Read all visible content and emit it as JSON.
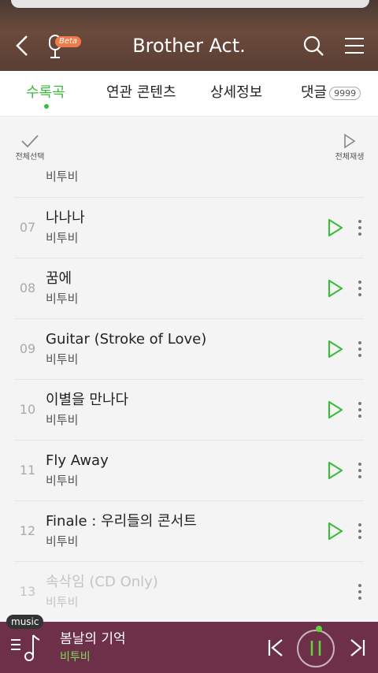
{
  "header": {
    "title": "Brother Act.",
    "beta_label": "Beta"
  },
  "tabs": [
    {
      "label": "수록곡",
      "active": true
    },
    {
      "label": "연관 콘텐츠",
      "active": false
    },
    {
      "label": "상세정보",
      "active": false
    },
    {
      "label": "댓글",
      "count": "9999",
      "active": false
    }
  ],
  "toolbar": {
    "select_all_label": "전체선택",
    "play_all_label": "전체재생"
  },
  "partial_row_artist": "비투비",
  "tracks": [
    {
      "num": "07",
      "title": "나나나",
      "artist": "비투비",
      "disabled": false
    },
    {
      "num": "08",
      "title": "꿈에",
      "artist": "비투비",
      "disabled": false
    },
    {
      "num": "09",
      "title": "Guitar (Stroke of Love)",
      "artist": "비투비",
      "disabled": false
    },
    {
      "num": "10",
      "title": "이별을 만나다",
      "artist": "비투비",
      "disabled": false
    },
    {
      "num": "11",
      "title": "Fly Away",
      "artist": "비투비",
      "disabled": false
    },
    {
      "num": "12",
      "title": "Finale : 우리들의 콘서트",
      "artist": "비투비",
      "disabled": false
    },
    {
      "num": "13",
      "title": "속삭임 (CD Only)",
      "artist": "비투비",
      "disabled": true
    }
  ],
  "player": {
    "tag": "music",
    "now_playing_title": "봄날의 기억",
    "now_playing_artist": "비투비"
  },
  "colors": {
    "accent_green": "#3dbb3d",
    "player_bg": "#6e2f48"
  }
}
